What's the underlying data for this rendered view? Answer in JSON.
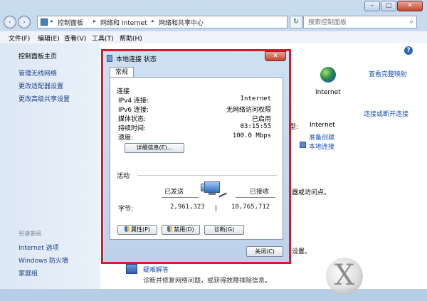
{
  "window": {
    "minimize": "–",
    "maximize": "□",
    "close": "✕"
  },
  "nav": {
    "back": "‹",
    "forward": "›",
    "breadcrumbs": [
      "控制面板",
      "网络和 Internet",
      "网络和共享中心"
    ],
    "separator": "▸",
    "refresh": "↻",
    "search_placeholder": "搜索控制面板"
  },
  "menu": [
    "文件(F)",
    "编辑(E)",
    "查看(V)",
    "工具(T)",
    "帮助(H)"
  ],
  "sidebar": {
    "items": [
      "控制面板主页",
      "管理无线网络",
      "更改适配器设置",
      "更改高级共享设置"
    ],
    "see_also_heading": "另请参阅",
    "see_also": [
      "Internet 选项",
      "Windows 防火墙",
      "家庭组"
    ]
  },
  "main": {
    "help": "?",
    "view_full_map": "查看完整映射",
    "internet_label": "Internet",
    "connect_or_disconnect": "连接或断开连接",
    "access_fragment": "型:",
    "access_value": "Internet",
    "homegroup_link": "准备创建",
    "connection_link": "本地连接",
    "fragment_router": "器或访问点。",
    "fragment_settings": "设置。",
    "troubleshoot_title": "疑难解答",
    "troubleshoot_desc": "诊断并修复网络问题，或获得故障排除信息。"
  },
  "dialog": {
    "title": "本地连接 状态",
    "close": "✕",
    "tab": "常规",
    "connection_heading": "连接",
    "rows": [
      {
        "label": "IPv4 连接:",
        "value": "Internet"
      },
      {
        "label": "IPv6 连接:",
        "value": "无网络访问权限"
      },
      {
        "label": "媒体状态:",
        "value": "已启用"
      },
      {
        "label": "持续时间:",
        "value": "03:15:55"
      },
      {
        "label": "速度:",
        "value": "100.0 Mbps"
      }
    ],
    "details_button": "详细信息(E)...",
    "activity_heading": "活动",
    "sent_label": "已发送",
    "received_label": "已接收",
    "bytes_label": "字节:",
    "bytes_sent": "2,961,323",
    "bytes_received": "10,765,712",
    "properties_button": "属性(P)",
    "disable_button": "禁用(D)",
    "diagnose_button": "诊断(G)",
    "close_button": "关闭(C)"
  },
  "watermark": {
    "glyph": "X"
  },
  "colors": {
    "highlight_frame": "#d9182b",
    "link": "#1a51b3"
  }
}
